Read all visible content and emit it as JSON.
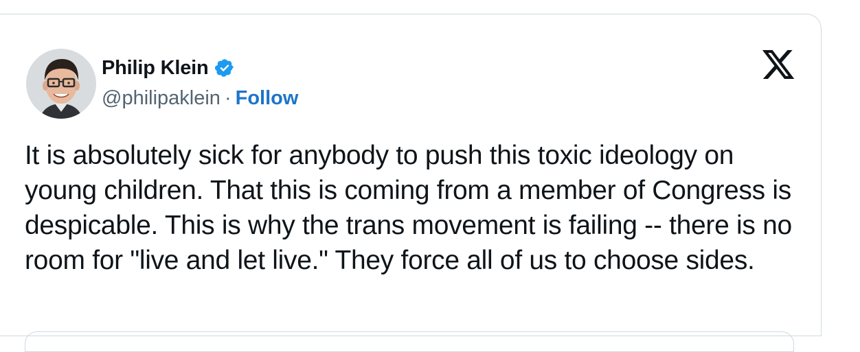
{
  "tweet": {
    "author_name": "Philip Klein",
    "handle": "@philipaklein",
    "separator": "·",
    "follow_label": "Follow",
    "text": "It is absolutely sick for anybody to push this toxic ideology on young children. That this is coming from a member of Congress is despicable. This is why the trans movement is failing -- there is no room for \"live and let live.\" They force all of us to choose sides."
  },
  "icons": {
    "verified": "verified-badge-icon",
    "platform": "x-logo-icon"
  },
  "colors": {
    "follow": "#1d74c8",
    "verified": "#1d9bf0",
    "text": "#0f1419",
    "secondary": "#536471",
    "border": "#cfd9de"
  }
}
